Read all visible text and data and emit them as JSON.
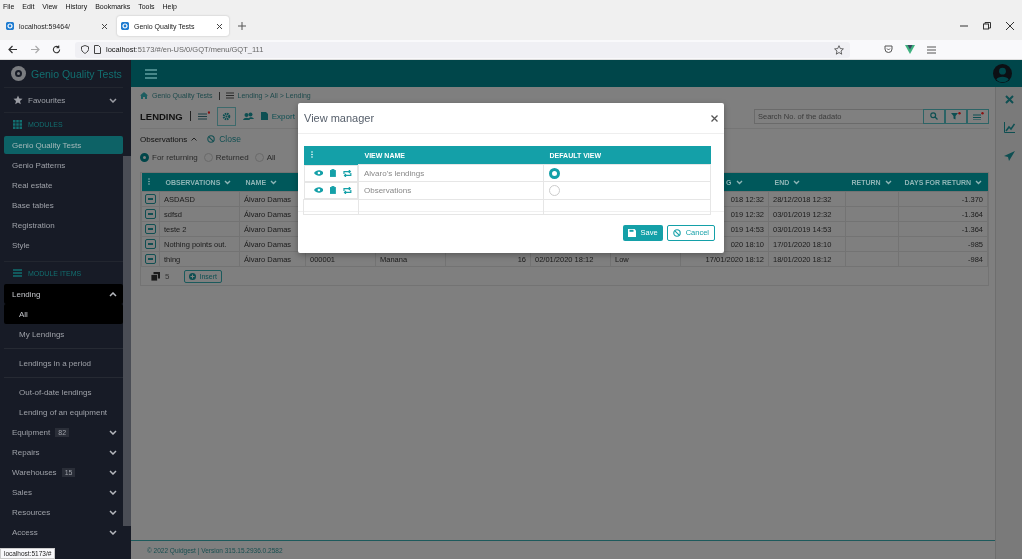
{
  "browser": {
    "menu": [
      "File",
      "Edit",
      "View",
      "History",
      "Bookmarks",
      "Tools",
      "Help"
    ],
    "tabs": [
      {
        "title": "localhost:59464/",
        "selected": false
      },
      {
        "title": "Genio Quality Tests",
        "selected": true
      }
    ],
    "url": "**localhost**:5173/#/en-US/0/GQT/menu/GQT_111"
  },
  "sidebar": {
    "brand": "Genio Quality Tests",
    "favourites": "Favourites",
    "modules_heading": "MODULES",
    "modules": [
      {
        "label": "Genio Quality Tests",
        "selected": true
      },
      {
        "label": "Genio Patterns",
        "selected": false
      },
      {
        "label": "Real estate",
        "selected": false
      },
      {
        "label": "Base tables",
        "selected": false
      },
      {
        "label": "Registration",
        "selected": false
      },
      {
        "label": "Style",
        "selected": false
      }
    ],
    "items_heading": "MODULE ITEMS",
    "items": [
      {
        "label": "Lending",
        "expanded": true,
        "children": [
          {
            "label": "All",
            "selected": true,
            "separated": false
          },
          {
            "label": "My Lendings",
            "selected": false,
            "separated": false
          },
          {
            "label": "Lendings in a period",
            "selected": false,
            "separated": true
          },
          {
            "label": "Out-of-date lendings",
            "selected": false,
            "separated": true
          },
          {
            "label": "Lending of an equipment",
            "selected": false,
            "separated": false
          }
        ]
      },
      {
        "label": "Equipment",
        "badge": "82",
        "expanded": false
      },
      {
        "label": "Repairs",
        "expanded": false
      },
      {
        "label": "Warehouses",
        "badge": "15",
        "expanded": false
      },
      {
        "label": "Sales",
        "expanded": false
      },
      {
        "label": "Resources",
        "expanded": false
      },
      {
        "label": "Access",
        "expanded": false
      }
    ]
  },
  "main": {
    "breadcrumb": [
      "Genio Quality Tests",
      "Lending > All > Lending"
    ],
    "title": "LENDING",
    "export": "Export",
    "search": {
      "placeholder": "Search No. of the dadato"
    },
    "panel": {
      "title": "Observations",
      "close": "Close"
    },
    "filters": [
      {
        "label": "For returning",
        "selected": true
      },
      {
        "label": "Returned",
        "selected": false
      },
      {
        "label": "All",
        "selected": false
      }
    ],
    "table": {
      "columns": [
        {
          "label": "OBSERVATIONS"
        },
        {
          "label": "NAME"
        },
        {},
        {},
        {},
        {},
        {},
        {
          "label": "G"
        },
        {
          "label": "END"
        },
        {
          "label": "RETURN"
        },
        {
          "label": "DAYS FOR RETURN"
        }
      ],
      "rows": [
        [
          "ASDASD",
          "Álvaro Damas",
          null,
          null,
          null,
          null,
          null,
          "018 12:32",
          "28/12/2018 12:32",
          null,
          "-1.370"
        ],
        [
          "sdfsd",
          "Álvaro Damas",
          null,
          null,
          null,
          null,
          null,
          "019 12:32",
          "03/01/2019 12:32",
          null,
          "-1.364"
        ],
        [
          "teste 2",
          "Álvaro Damas",
          null,
          null,
          null,
          null,
          null,
          "019 14:53",
          "03/01/2019 14:53",
          null,
          "-1.364"
        ],
        [
          "Nothing points out.",
          "Álvaro Damas",
          null,
          null,
          null,
          null,
          null,
          "020 18:10",
          "17/01/2020 18:10",
          null,
          "-985"
        ],
        [
          "thing",
          "Álvaro Damas",
          "000001",
          "Manana",
          "16",
          "02/01/2020 18:12",
          "Low",
          "17/01/2020 18:12",
          "18/01/2020 18:12",
          null,
          "-984"
        ]
      ],
      "count": "5",
      "insert": "Insert"
    }
  },
  "modal": {
    "title": "View manager",
    "columns": [
      "VIEW NAME",
      "DEFAULT VIEW"
    ],
    "rows": [
      {
        "name": "Alvaro's lendings",
        "default": true
      },
      {
        "name": "Observations",
        "default": false
      }
    ],
    "save": "Save",
    "cancel": "Cancel"
  },
  "footer": "© 2022 Quidgest | Version 315.15.2936.0.2582",
  "status_url": "localhost:5173/#"
}
